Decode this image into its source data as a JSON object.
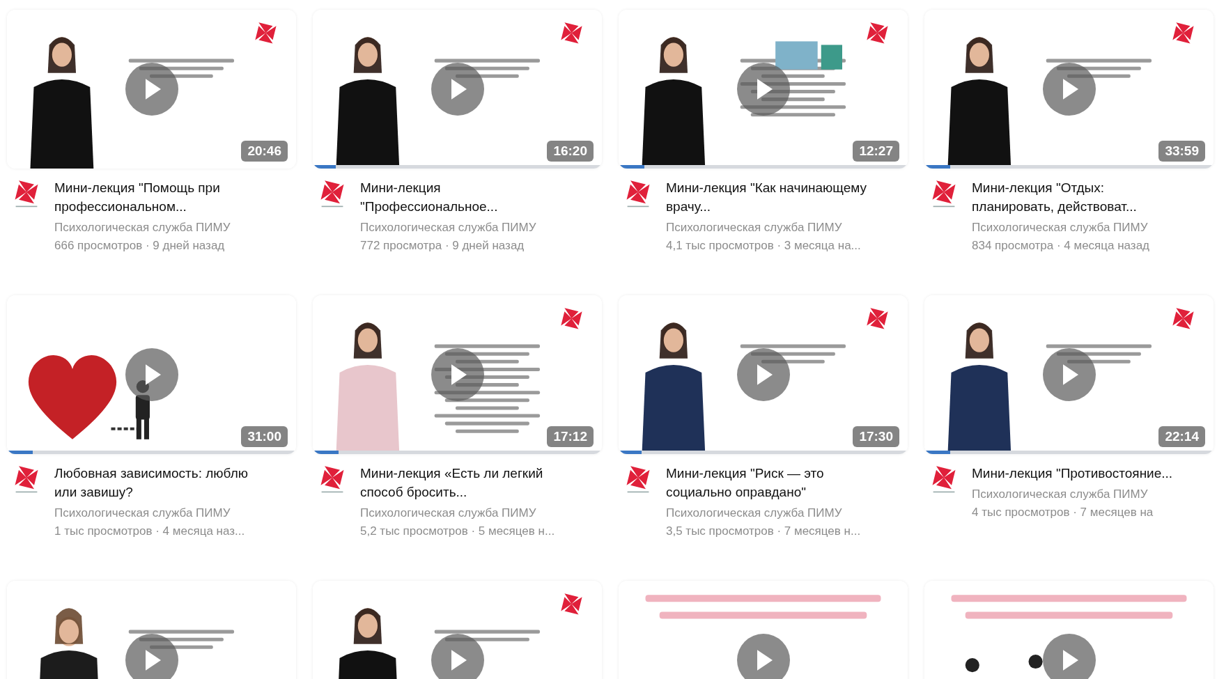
{
  "videos": [
    {
      "thumbnail": {
        "kind": "picture"
      },
      "title": "Мини-лекция \"Помощь при профессиональном...",
      "channel": "Психологическая служба ПИМУ",
      "meta": "666 просмотров · 9 дней назад",
      "duration": "20:46"
    },
    {
      "thumbnail": {
        "kind": "picture"
      },
      "title": "Мини-лекция \"Профессиональное...",
      "channel": "Психологическая служба ПИМУ",
      "meta": "772 просмотра · 9 дней назад",
      "duration": "16:20",
      "watched": {
        "level": 0.08
      }
    },
    {
      "thumbnail": {
        "kind": "picture"
      },
      "title": "Мини-лекция \"Как начинающему врачу...",
      "channel": "Психологическая служба ПИМУ",
      "meta": "4,1 тыс просмотров · 3 месяца на...",
      "duration": "12:27",
      "watched": {
        "level": 0.09
      }
    },
    {
      "thumbnail": {
        "kind": "picture"
      },
      "title": "Мини-лекция \"Отдых: планировать, действоват...",
      "channel": "Психологическая служба ПИМУ",
      "meta": "834 просмотра · 4 месяца назад",
      "duration": "33:59",
      "watched": {
        "level": 0.09
      }
    },
    {
      "thumbnail": {
        "kind": "picture"
      },
      "title": "Любовная зависимость: люблю или завишу?",
      "channel": "Психологическая служба ПИМУ",
      "meta": "1 тыс просмотров · 4 месяца наз...",
      "duration": "31:00",
      "watched": {
        "level": 0.09
      }
    },
    {
      "thumbnail": {
        "kind": "picture"
      },
      "title": "Мини-лекция «Есть ли легкий способ бросить...",
      "channel": "Психологическая служба ПИМУ",
      "meta": "5,2 тыс просмотров · 5 месяцев н...",
      "duration": "17:12",
      "watched": {
        "level": 0.09
      }
    },
    {
      "thumbnail": {
        "kind": "picture"
      },
      "title": "Мини-лекция \"Риск — это социально оправдано\"",
      "channel": "Психологическая служба ПИМУ",
      "meta": "3,5 тыс просмотров · 7 месяцев н...",
      "duration": "17:30",
      "watched": {
        "level": 0.08
      }
    },
    {
      "thumbnail": {
        "kind": "picture"
      },
      "title": "Мини-лекция \"Противостояние...",
      "channel": "Психологическая служба ПИМУ",
      "meta": "4 тыс просмотров · 7 месяцев на",
      "duration": "22:14",
      "watched": {
        "level": 0.09
      }
    },
    {
      "thumbnail": {
        "kind": "picture"
      }
    },
    {
      "thumbnail": {
        "kind": "picture"
      }
    },
    {
      "thumbnail": {
        "kind": "picture"
      }
    },
    {
      "thumbnail": {
        "kind": "picture"
      }
    }
  ]
}
